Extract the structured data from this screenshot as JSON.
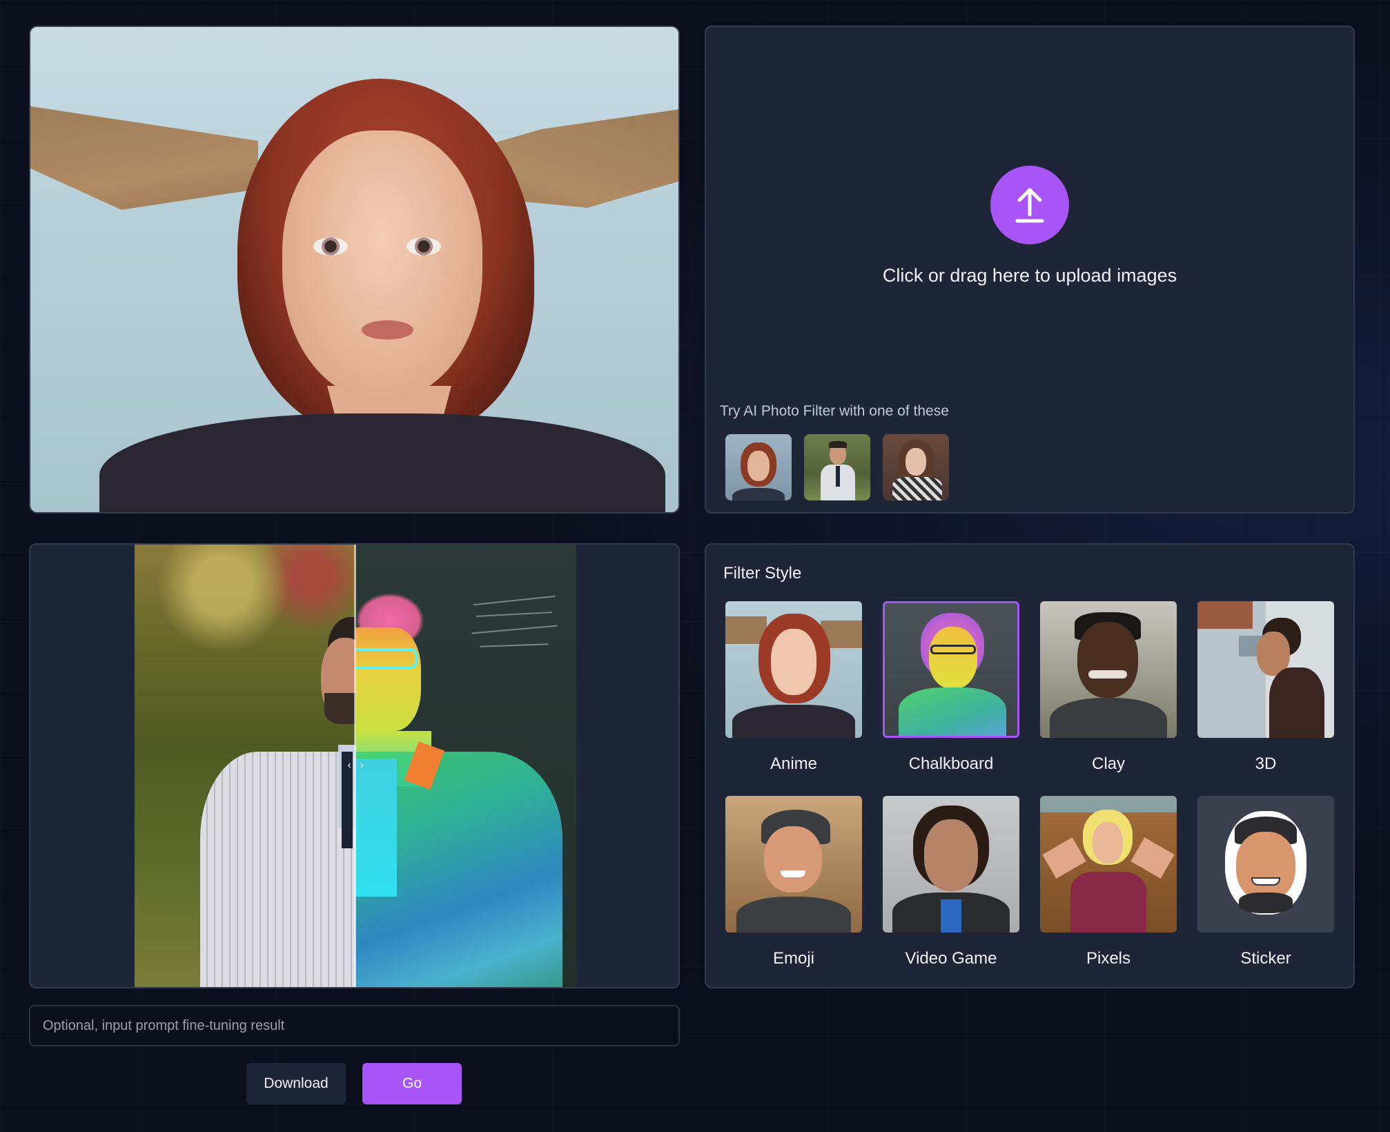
{
  "upload": {
    "text": "Click or drag here to upload images",
    "try_label": "Try AI Photo Filter with one of these",
    "samples": [
      {
        "name": "sample-woman-redhead"
      },
      {
        "name": "sample-man-suit"
      },
      {
        "name": "sample-woman-glasses"
      }
    ]
  },
  "compare": {
    "handle_left": "‹",
    "handle_right": "›"
  },
  "filter_style": {
    "title": "Filter Style",
    "selected": "Chalkboard",
    "styles": [
      {
        "label": "Anime"
      },
      {
        "label": "Chalkboard"
      },
      {
        "label": "Clay"
      },
      {
        "label": "3D"
      },
      {
        "label": "Emoji"
      },
      {
        "label": "Video Game"
      },
      {
        "label": "Pixels"
      },
      {
        "label": "Sticker"
      }
    ]
  },
  "prompt": {
    "placeholder": "Optional, input prompt fine-tuning result",
    "value": ""
  },
  "actions": {
    "download_label": "Download",
    "go_label": "Go"
  },
  "colors": {
    "accent": "#a855f7",
    "background": "#0b0e1c",
    "panel": "#1e2536"
  },
  "icons": {
    "upload": "upload-arrow-icon"
  }
}
